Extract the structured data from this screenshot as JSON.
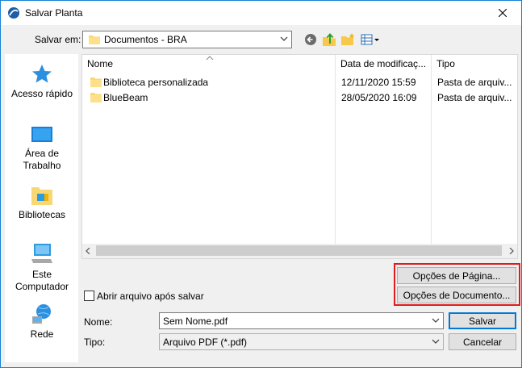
{
  "window": {
    "title": "Salvar Planta",
    "close_icon": "close-icon"
  },
  "toolbar": {
    "save_in_label": "Salvar em:",
    "location_value": "Documentos - BRA",
    "icons": [
      "back-icon",
      "up-folder-icon",
      "new-folder-icon",
      "view-menu-icon"
    ]
  },
  "places": [
    {
      "label": "Acesso rápido",
      "icon": "star-icon"
    },
    {
      "label": "Área de Trabalho",
      "icon": "desktop-icon"
    },
    {
      "label": "Bibliotecas",
      "icon": "libraries-icon"
    },
    {
      "label": "Este Computador",
      "icon": "computer-icon"
    },
    {
      "label": "Rede",
      "icon": "network-icon"
    }
  ],
  "list": {
    "columns": [
      "Nome",
      "Data de modificaç...",
      "Tipo"
    ],
    "rows": [
      {
        "name": "Biblioteca personalizada",
        "date": "12/11/2020 15:59",
        "type": "Pasta de arquiv..."
      },
      {
        "name": "BlueBeam",
        "date": "28/05/2020 16:09",
        "type": "Pasta de arquiv..."
      }
    ]
  },
  "options": {
    "page_button": "Opções de Página...",
    "document_button": "Opções de Documento...",
    "open_after_save": "Abrir arquivo após salvar"
  },
  "footer": {
    "name_label": "Nome:",
    "name_value": "Sem Nome.pdf",
    "type_label": "Tipo:",
    "type_value": "Arquivo PDF (*.pdf)",
    "save_button": "Salvar",
    "cancel_button": "Cancelar"
  },
  "colors": {
    "highlight_box": "#e11b1b",
    "default_button_border": "#0078d7",
    "folder": "#f8d775"
  }
}
